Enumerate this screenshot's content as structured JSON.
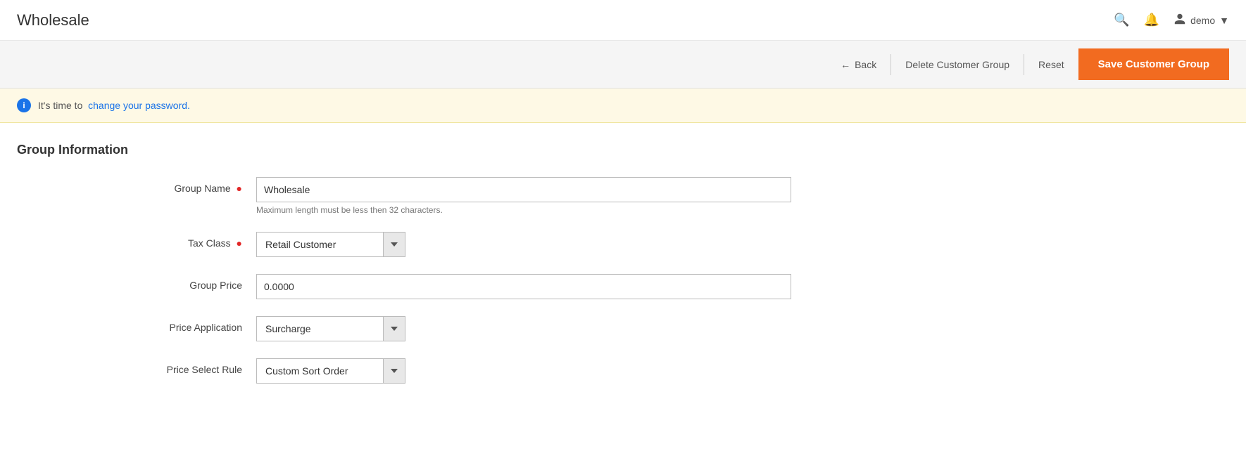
{
  "app": {
    "title": "Wholesale"
  },
  "header": {
    "search_icon": "🔍",
    "bell_icon": "🔔",
    "user_icon": "👤",
    "user_name": "demo",
    "user_arrow": "▼"
  },
  "action_bar": {
    "back_arrow": "←",
    "back_label": "Back",
    "delete_label": "Delete Customer Group",
    "reset_label": "Reset",
    "save_label": "Save Customer Group"
  },
  "notification": {
    "info_icon": "i",
    "prefix_text": "It's time to",
    "link_text": "change your password.",
    "suffix_text": ""
  },
  "section": {
    "title": "Group Information"
  },
  "form": {
    "group_name": {
      "label": "Group Name",
      "required": true,
      "value": "Wholesale",
      "hint": "Maximum length must be less then 32 characters."
    },
    "tax_class": {
      "label": "Tax Class",
      "required": true,
      "value": "Retail Customer"
    },
    "group_price": {
      "label": "Group Price",
      "required": false,
      "value": "0.0000"
    },
    "price_application": {
      "label": "Price Application",
      "required": false,
      "value": "Surcharge"
    },
    "price_select_rule": {
      "label": "Price Select Rule",
      "required": false,
      "value": "Custom Sort Order"
    }
  }
}
